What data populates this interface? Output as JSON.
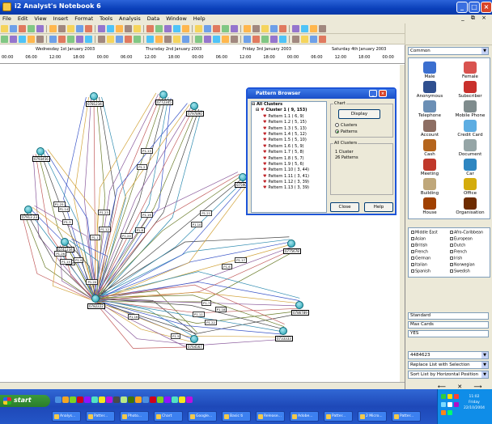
{
  "window": {
    "title": "i2 Analyst's Notebook 6"
  },
  "menu": [
    "File",
    "Edit",
    "View",
    "Insert",
    "Format",
    "Tools",
    "Analysis",
    "Data",
    "Window",
    "Help"
  ],
  "timeline": {
    "days": [
      "Wednesday 1st January 2003",
      "Thursday 2nd January 2003",
      "Friday 3rd January 2003",
      "Saturday 4th January 2003"
    ],
    "ticks": [
      "00:00",
      "06:00",
      "12:00",
      "18:00",
      "00:00",
      "06:00",
      "12:00",
      "18:00",
      "00:00",
      "06:00",
      "12:00",
      "18:00",
      "00:00",
      "06:00",
      "12:00",
      "18:00",
      "00:00"
    ]
  },
  "chart": {
    "nodes": [
      {
        "label": "0781234"
      },
      {
        "label": "0772345"
      },
      {
        "label": "0793456"
      },
      {
        "label": "07913 23"
      },
      {
        "label": "0782222"
      },
      {
        "label": "0764567"
      },
      {
        "label": "0775678"
      },
      {
        "label": "0786789"
      },
      {
        "label": "0797890"
      },
      {
        "label": "0741234"
      },
      {
        "label": "0759012"
      },
      {
        "label": "0733333"
      }
    ],
    "link_labels": [
      "P1.1",
      "P1.2",
      "P1.3",
      "P1.4",
      "P1.5",
      "P1.6",
      "P1.7",
      "P1.8",
      "P1.9",
      "P1.10",
      "P1.11",
      "P1.12",
      "P1.13",
      "P1.14",
      "P1.15",
      "P1.16",
      "P1.17",
      "P1.18",
      "P1.19",
      "P1.20",
      "P1.21",
      "P1.22",
      "P1.23",
      "P1.24",
      "P1.25",
      "P1.26"
    ]
  },
  "dialog": {
    "title": "Pattern Browser",
    "tree_root": "All Clusters",
    "cluster": "Cluster 1  ( 9, 153)",
    "patterns": [
      "Pattern 1.1  ( 6, 9)",
      "Pattern 1.2  ( 5, 15)",
      "Pattern 1.3  ( 5, 13)",
      "Pattern 1.4  ( 5, 12)",
      "Pattern 1.5  ( 5, 10)",
      "Pattern 1.6  ( 5, 9)",
      "Pattern 1.7  ( 5, 8)",
      "Pattern 1.8  ( 5, 7)",
      "Pattern 1.9  ( 5, 6)",
      "Pattern 1.10  ( 3, 44)",
      "Pattern 1.11  ( 3, 41)",
      "Pattern 1.12  ( 3, 39)",
      "Pattern 1.13  ( 3, 39)"
    ],
    "chart_group": "Chart",
    "display_btn": "Display",
    "radio_clusters": "Clusters",
    "radio_patterns": "Patterns",
    "info_group": "All Clusters",
    "info_line1": "1 Cluster",
    "info_line2": "26 Patterns",
    "close_btn": "Close",
    "help_btn": "Help"
  },
  "sidepanel": {
    "palette_combo": "Common",
    "items": [
      "Male",
      "Female",
      "Anonymous",
      "Subscriber",
      "Telephone",
      "Mobile Phone",
      "Account",
      "Credit Card",
      "Cash",
      "Document",
      "Meeting",
      "Car",
      "Building",
      "Office",
      "House",
      "Organisation"
    ],
    "attributes": [
      [
        "Middle East",
        "Afro-Caribbean"
      ],
      [
        "Asian",
        "European"
      ],
      [
        "British",
        "Dutch"
      ],
      [
        "French",
        "French"
      ],
      [
        "German",
        "Irish"
      ],
      [
        "Italian",
        "Norwegian"
      ],
      [
        "Spanish",
        "Swedish"
      ]
    ],
    "style_field": "Standard",
    "style_field2": "Max Cards",
    "style_field3": "YES",
    "number_combo": "4484623",
    "mode_combo": "Replace List with Selection",
    "sort_combo": "Sort List by Horizontal Position"
  },
  "taskbar": {
    "start": "start",
    "tasks": [
      "Analys...",
      "Patter...",
      "Photo...",
      "Chart",
      "Google...",
      "Basic ti",
      "Release...",
      "Adobe...",
      "Patter...",
      "2 Micro...",
      "Patter..."
    ],
    "clock_line1": "11:02",
    "clock_line2": "Friday",
    "clock_line3": "22/10/2004"
  }
}
